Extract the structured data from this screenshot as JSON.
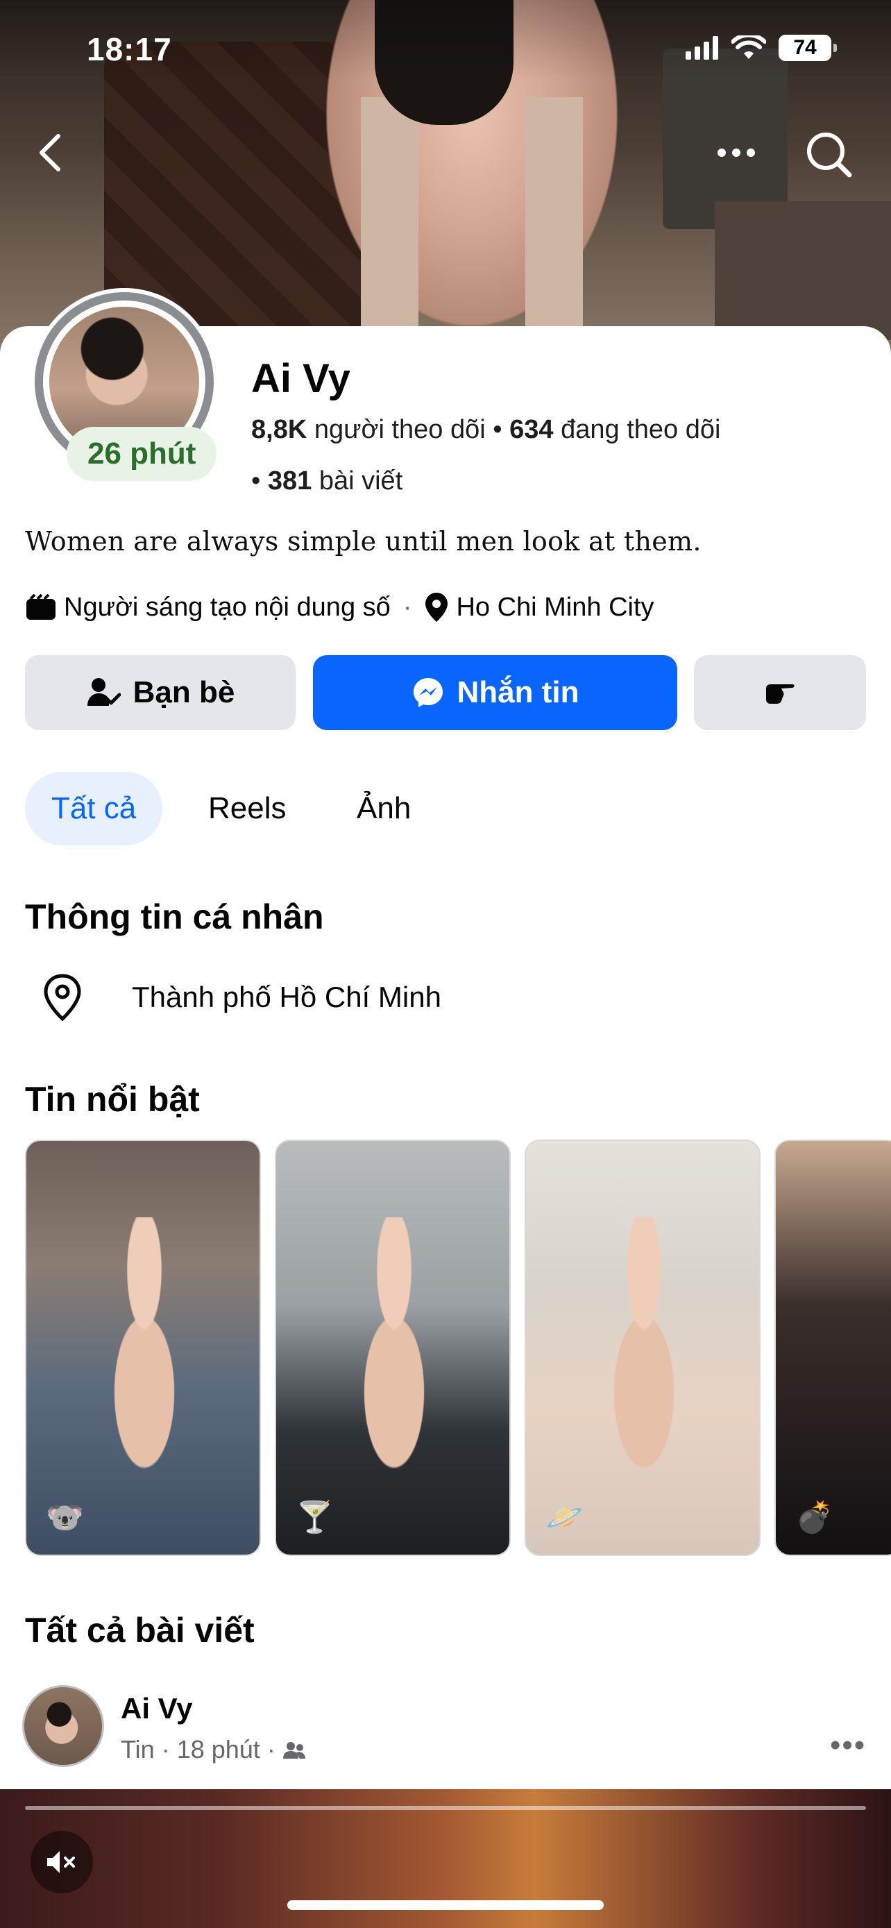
{
  "status_bar": {
    "time": "18:17",
    "battery": "74"
  },
  "profile": {
    "name": "Ai Vy",
    "story_time": "26 phút",
    "followers_count": "8,8K",
    "followers_label": "người theo dõi",
    "following_count": "634",
    "following_label": "đang theo dõi",
    "posts_count": "381",
    "posts_label": "bài viết",
    "bio": "Women are always simple until men look at them.",
    "category": "Người sáng tạo nội dung số",
    "city": "Ho Chi Minh City"
  },
  "actions": {
    "friends_label": "Bạn bè",
    "message_label": "Nhắn tin",
    "accent_color": "#0866ff"
  },
  "tabs": [
    {
      "label": "Tất cả",
      "active": true
    },
    {
      "label": "Reels",
      "active": false
    },
    {
      "label": "Ảnh",
      "active": false
    }
  ],
  "personal_info": {
    "title": "Thông tin cá nhân",
    "location": "Thành phố Hồ Chí Minh"
  },
  "highlights": {
    "title": "Tin nổi bật",
    "items": [
      {
        "emoji": "🐨"
      },
      {
        "emoji": "🍸"
      },
      {
        "emoji": "🪐"
      },
      {
        "emoji": "💣"
      }
    ]
  },
  "posts": {
    "title": "Tất cả bài viết",
    "first": {
      "author": "Ai Vy",
      "type": "Tin",
      "time": "18 phút",
      "audience_icon": "friends-icon"
    }
  }
}
